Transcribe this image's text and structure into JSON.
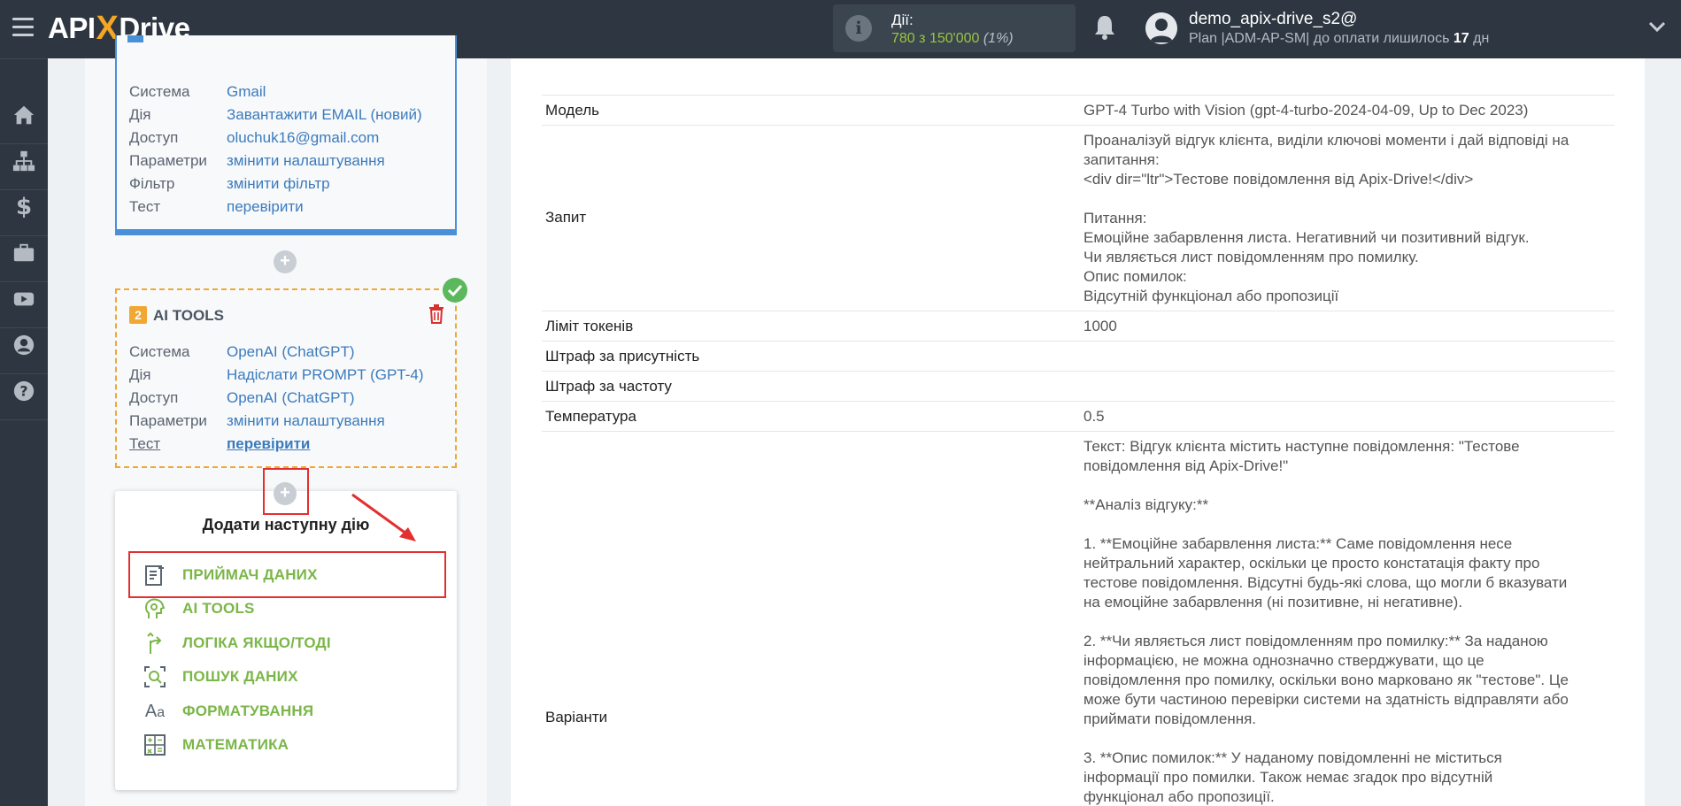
{
  "topbar": {
    "logo_left": "API",
    "logo_x": "X",
    "logo_right": "Drive",
    "actions_label": "Дії:",
    "actions_used": "780",
    "actions_sep": " з ",
    "actions_total": "150'000",
    "actions_pct": "(1%)",
    "user_name": "demo_apix-drive_s2@",
    "plan_text": "Plan |ADM-AP-SM| до оплати лишилось ",
    "plan_days": "17",
    "plan_unit": " дн"
  },
  "nav": {
    "items": [
      "home-icon",
      "sitemap-icon",
      "dollar-icon",
      "briefcase-icon",
      "youtube-icon",
      "user-icon",
      "help-icon"
    ]
  },
  "card1": {
    "rows": [
      {
        "k": "Система",
        "v": "Gmail"
      },
      {
        "k": "Дія",
        "v": "Завантажити EMAIL (новий)"
      },
      {
        "k": "Доступ",
        "v": "oluchuk16@gmail.com"
      },
      {
        "k": "Параметри",
        "v": "змінити налаштування"
      },
      {
        "k": "Фільтр",
        "v": "змінити фільтр"
      },
      {
        "k": "Тест",
        "v": "перевірити"
      }
    ]
  },
  "card2": {
    "num": "2",
    "title": "AI TOOLS",
    "rows": [
      {
        "k": "Система",
        "v": "OpenAI (ChatGPT)"
      },
      {
        "k": "Дія",
        "v": "Надіслати PROMPT (GPT-4)"
      },
      {
        "k": "Доступ",
        "v": "OpenAI (ChatGPT)"
      },
      {
        "k": "Параметри",
        "v": "змінити налаштування"
      },
      {
        "k": "Тест",
        "v": "перевірити"
      }
    ]
  },
  "add_panel": {
    "title": "Додати наступну дію",
    "items": [
      {
        "label": "ПРИЙМАЧ ДАНИХ",
        "icon": "data-receiver-icon"
      },
      {
        "label": "AI TOOLS",
        "icon": "ai-tools-icon"
      },
      {
        "label": "ЛОГІКА ЯКЩО/ТОДІ",
        "icon": "logic-branch-icon"
      },
      {
        "label": "ПОШУК ДАНИХ",
        "icon": "data-search-icon"
      },
      {
        "label": "ФОРМАТУВАННЯ",
        "icon": "formatting-icon"
      },
      {
        "label": "МАТЕМАТИКА",
        "icon": "math-icon"
      }
    ]
  },
  "details": {
    "rows": [
      {
        "label": "Модель",
        "value": "GPT-4 Turbo with Vision (gpt-4-turbo-2024-04-09, Up to Dec 2023)"
      },
      {
        "label": "Запит",
        "value": "Проаналізуй відгук клієнта, виділи ключові моменти і дай відповіді на\nзапитання:\n<div dir=\"ltr\">Тестове повідомлення від Apix-Drive!</div>\n\nПитання:\nЕмоційне забарвлення листа. Негативний чи позитивний відгук.\nЧи являється лист повідомленням про помилку.\nОпис помилок:\nВідсутній функціонал або пропозиції"
      },
      {
        "label": "Ліміт токенів",
        "value": "1000"
      },
      {
        "label": "Штраф за присутність",
        "value": ""
      },
      {
        "label": "Штраф за частоту",
        "value": ""
      },
      {
        "label": "Температура",
        "value": "0.5"
      },
      {
        "label": "Варіанти",
        "value": "Текст: Відгук клієнта містить наступне повідомлення: \"Тестове\nповідомлення від Apix-Drive!\"\n\n**Аналіз відгуку:**\n\n1. **Емоційне забарвлення листа:** Саме повідомлення несе\nнейтральний характер, оскільки це просто констатація факту про\nтестове повідомлення. Відсутні будь-які слова, що могли б вказувати\nна емоційне забарвлення (ні позитивне, ні негативне).\n\n2. **Чи являється лист повідомленням про помилку:** За наданою\nінформацією, не можна однозначно стверджувати, що це\nповідомлення про помилку, оскільки воно марковано як \"тестове\". Це\nможе бути частиною перевірки системи на здатність відправляти або\nприймати повідомлення.\n\n3. **Опис помилок:** У наданому повідомленні не міститься\nінформації про помилки. Також немає згадок про відсутній\nфункціонал або пропозиції."
      }
    ]
  }
}
